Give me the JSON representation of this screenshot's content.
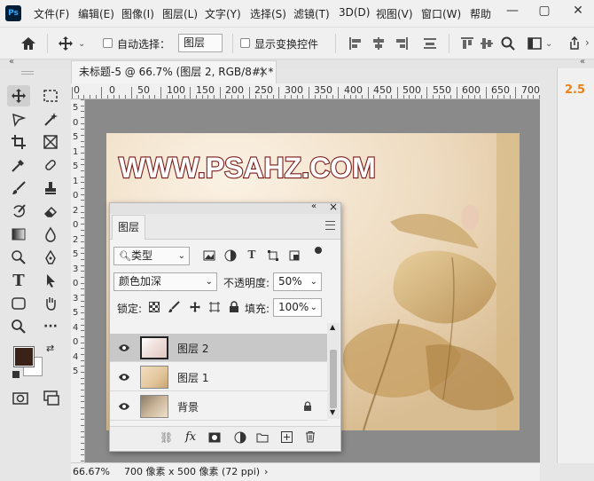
{
  "app": {
    "logo_text": "Ps"
  },
  "menu": [
    "文件(F)",
    "编辑(E)",
    "图像(I)",
    "图层(L)",
    "文字(Y)",
    "选择(S)",
    "滤镜(T)",
    "3D(D)",
    "视图(V)",
    "窗口(W)",
    "帮助"
  ],
  "window_controls": {
    "minimize": "—",
    "maximize": "▢",
    "close": "✕"
  },
  "options": {
    "auto_select_label": "自动选择：",
    "auto_select_target": "图层",
    "show_transform_label": "显示变换控件"
  },
  "document": {
    "tab_title": "未标题-5 @ 66.7% (图层 2, RGB/8#) *",
    "close_glyph": "×",
    "ruler_h_labels": [
      "0",
      "0",
      "50",
      "100",
      "150",
      "200",
      "250",
      "300",
      "350",
      "400",
      "450",
      "500",
      "550",
      "600",
      "650",
      "700"
    ],
    "ruler_v_labels": [
      "5",
      "0",
      "5",
      "1",
      "5",
      "1",
      "0",
      "2",
      "0",
      "2",
      "5",
      "3",
      "0",
      "3",
      "5",
      "4",
      "0",
      "4",
      "5"
    ],
    "watermark": "WWW.PSAHZ.COM"
  },
  "status": {
    "zoom": "66.67%",
    "info": "700 像素 x 500 像素 (72 ppi)",
    "arrow": "›"
  },
  "right_panel": {
    "value": "2.5"
  },
  "layers_panel": {
    "tab": "图层",
    "collapse": "«",
    "close": "×",
    "filter_kind": "类型",
    "blend_mode": "颜色加深",
    "opacity_label": "不透明度:",
    "opacity_value": "50%",
    "lock_label": "锁定:",
    "fill_label": "填充:",
    "fill_value": "100%",
    "layers": [
      {
        "name": "图层 2",
        "selected": true
      },
      {
        "name": "图层 1",
        "selected": false
      },
      {
        "name": "背景",
        "selected": false,
        "locked": true
      }
    ],
    "footer_fx": "fx"
  },
  "colors": {
    "foreground": "#3b2219",
    "background": "#ffffff",
    "watermark_fill": "#ffffff",
    "watermark_stroke": "#7a1a1a",
    "accent_value": "#e8821e"
  }
}
